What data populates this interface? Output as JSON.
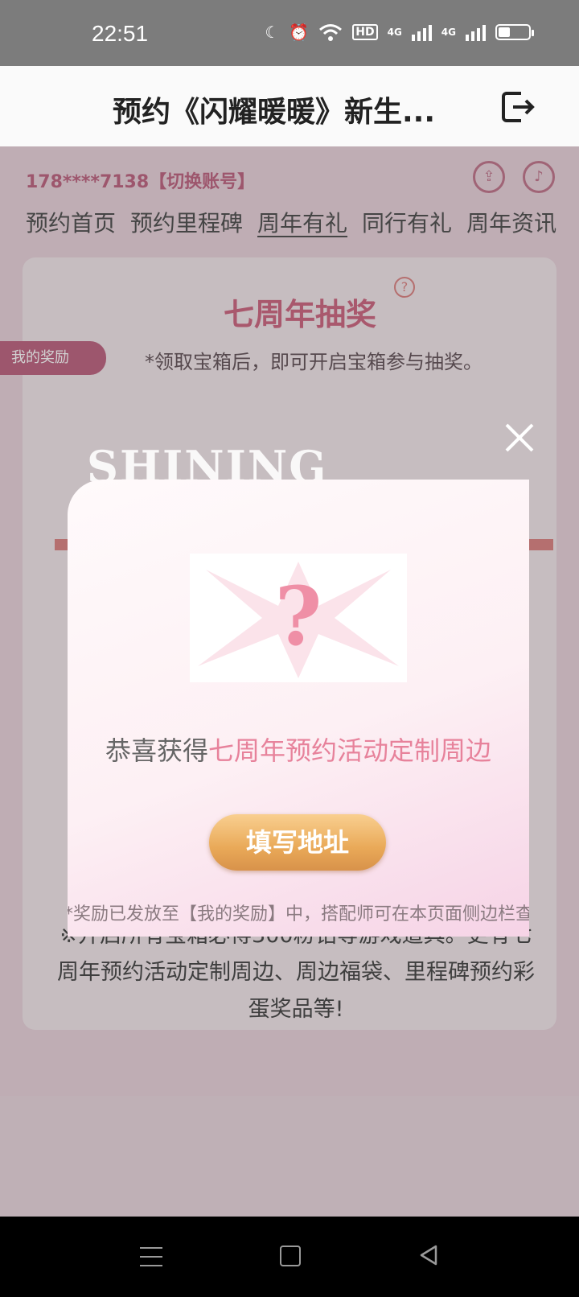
{
  "status_bar": {
    "time": "22:51",
    "hd": "HD",
    "lte1": "4G",
    "lte2": "4G"
  },
  "titlebar": {
    "title": "预约《闪耀暖暖》新生..."
  },
  "page": {
    "account": "178****7138【切换账号】",
    "nav": [
      "预约首页",
      "预约里程碑",
      "周年有礼",
      "同行有礼",
      "周年资讯"
    ],
    "lottery_title": "七周年抽奖",
    "lottery_hint": "*领取宝箱后，即可开启宝箱参与抽奖。",
    "reward_tab": "我的奖励",
    "bottom_text": "※开启所有宝箱必得300粉钻等游戏道具。更有七周年预约活动定制周边、周边福袋、里程碑预约彩蛋奖品等!",
    "shining": "SHINING"
  },
  "modal": {
    "congrats_prefix": "恭喜获得",
    "congrats_prize": "七周年预约活动定制周边",
    "fill_button": "填写地址",
    "note": "*奖励已发放至【我的奖励】中，搭配师可在本页面侧边栏查"
  }
}
